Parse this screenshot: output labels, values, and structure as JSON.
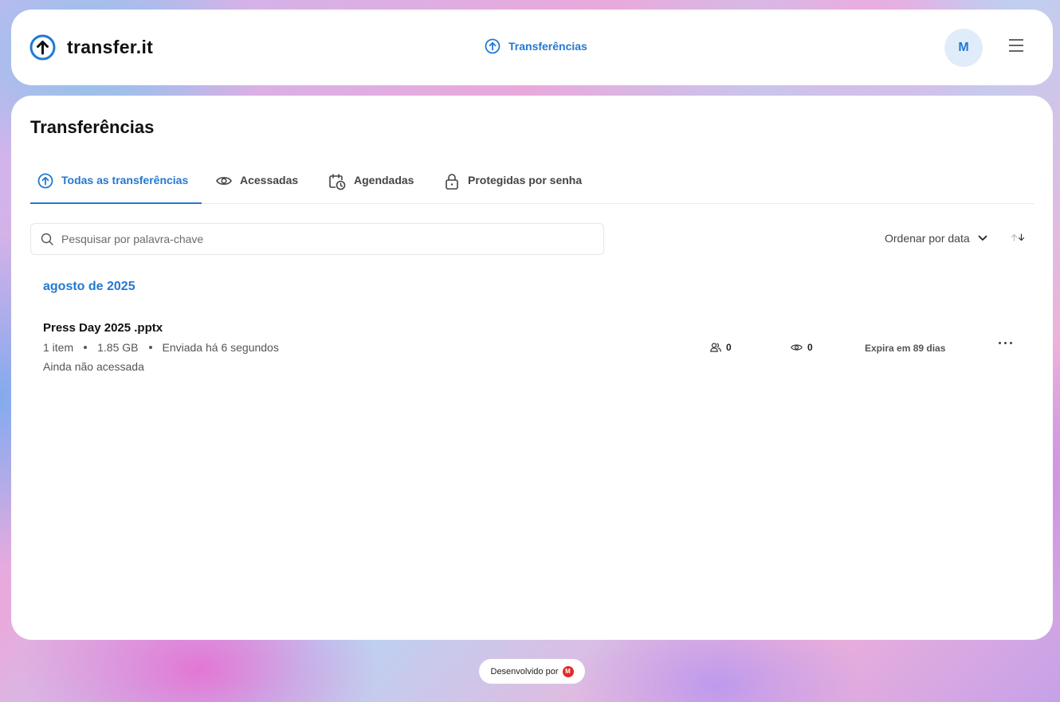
{
  "header": {
    "logo_text": "transfer.it",
    "nav_label": "Transferências",
    "avatar_initial": "M"
  },
  "page": {
    "title": "Transferências"
  },
  "tabs": [
    {
      "label": "Todas as transferências",
      "icon": "upload-circle-icon",
      "active": true
    },
    {
      "label": "Acessadas",
      "icon": "eye-icon",
      "active": false
    },
    {
      "label": "Agendadas",
      "icon": "calendar-clock-icon",
      "active": false
    },
    {
      "label": "Protegidas por senha",
      "icon": "lock-icon",
      "active": false
    }
  ],
  "search": {
    "placeholder": "Pesquisar por palavra-chave",
    "value": ""
  },
  "sort": {
    "label": "Ordenar por data"
  },
  "groups": [
    {
      "month": "agosto de 2025",
      "items": [
        {
          "name": "Press Day 2025 .pptx",
          "count": "1 item",
          "size": "1.85 GB",
          "sent": "Enviada há 6 segundos",
          "status": "Ainda não acessada",
          "recipients": "0",
          "views": "0",
          "expires": "Expira em 89 dias"
        }
      ]
    }
  ],
  "footer": {
    "label": "Desenvolvido por",
    "brand_letter": "M"
  },
  "colors": {
    "accent": "#2279d1",
    "brand_red": "#e02a2a"
  }
}
